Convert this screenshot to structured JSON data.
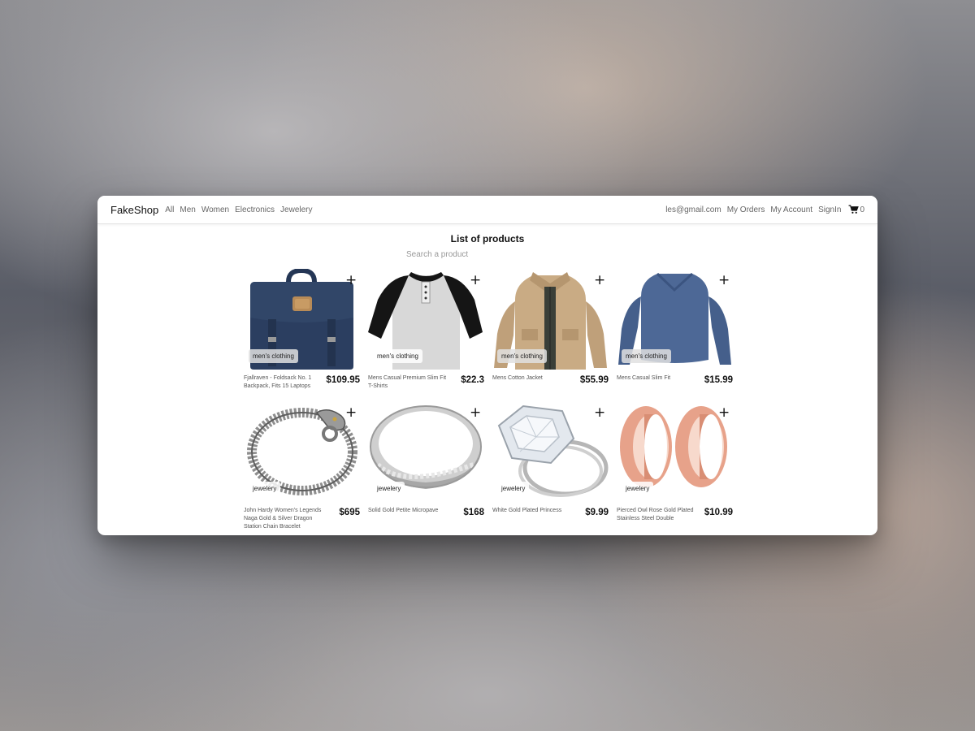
{
  "navbar": {
    "brand": "FakeShop",
    "links": [
      "All",
      "Men",
      "Women",
      "Electronics",
      "Jewelery"
    ],
    "user_email": "les@gmail.com",
    "my_orders": "My Orders",
    "my_account": "My Account",
    "sign_in": "SignIn",
    "cart_count": "0"
  },
  "main": {
    "heading": "List of products",
    "search_placeholder": "Search a product"
  },
  "products": [
    {
      "title": "Fjallraven - Foldsack No. 1 Backpack, Fits 15 Laptops",
      "price": "$109.95",
      "category": "men's clothing",
      "image": "backpack"
    },
    {
      "title": "Mens Casual Premium Slim Fit T-Shirts",
      "price": "$22.3",
      "category": "men's clothing",
      "image": "raglan-tshirt"
    },
    {
      "title": "Mens Cotton Jacket",
      "price": "$55.99",
      "category": "men's clothing",
      "image": "jacket"
    },
    {
      "title": "Mens Casual Slim Fit",
      "price": "$15.99",
      "category": "men's clothing",
      "image": "longsleeve-shirt"
    },
    {
      "title": "John Hardy Women's Legends Naga Gold & Silver Dragon Station Chain Bracelet",
      "price": "$695",
      "category": "jewelery",
      "image": "dragon-bracelet"
    },
    {
      "title": "Solid Gold Petite Micropave",
      "price": "$168",
      "category": "jewelery",
      "image": "silver-band-ring"
    },
    {
      "title": "White Gold Plated Princess",
      "price": "$9.99",
      "category": "jewelery",
      "image": "diamond-ring"
    },
    {
      "title": "Pierced Owl Rose Gold Plated Stainless Steel Double",
      "price": "$10.99",
      "category": "jewelery",
      "image": "rose-gold-plugs"
    }
  ]
}
